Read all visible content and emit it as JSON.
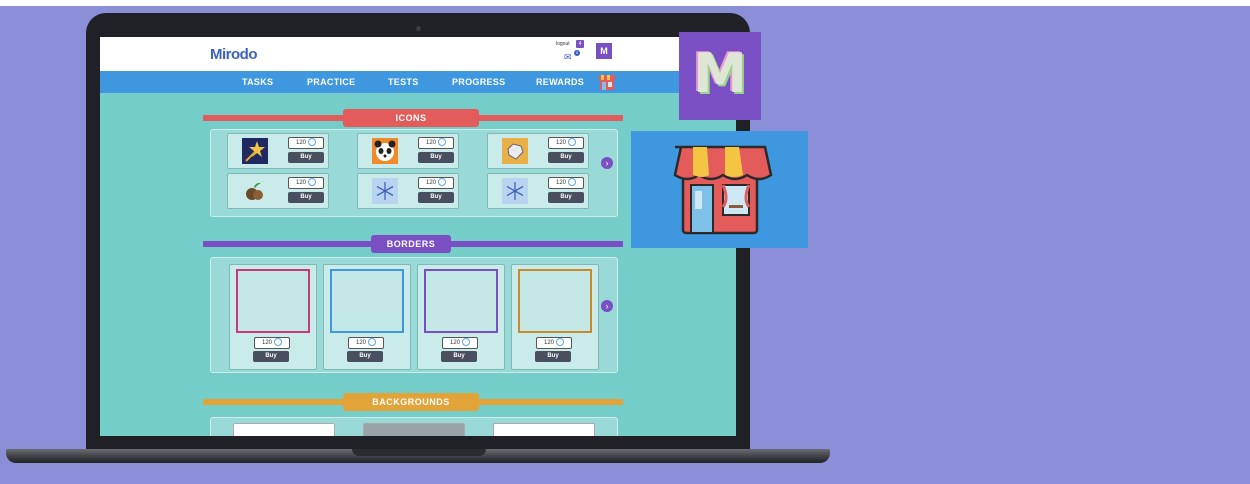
{
  "app": {
    "logo": "Mirodo",
    "header": {
      "logout": "logout",
      "logout_badge": "4",
      "mail_count": "0",
      "avatar_letter": "M"
    },
    "nav": {
      "items": [
        "TASKS",
        "PRACTICE",
        "TESTS",
        "PROGRESS",
        "REWARDS"
      ]
    }
  },
  "sections": {
    "icons": {
      "title": "ICONS",
      "items": [
        {
          "price": "120",
          "buy": "Buy",
          "icon": "star-wand-icon"
        },
        {
          "price": "120",
          "buy": "Buy",
          "icon": "panda-icon"
        },
        {
          "price": "120",
          "buy": "Buy",
          "icon": "diamond-icon"
        },
        {
          "price": "120",
          "buy": "Buy",
          "icon": "coconut-icon"
        },
        {
          "price": "120",
          "buy": "Buy",
          "icon": "snowflake-icon"
        },
        {
          "price": "120",
          "buy": "Buy",
          "icon": "snowflake-icon"
        }
      ]
    },
    "borders": {
      "title": "BORDERS",
      "items": [
        {
          "price": "120",
          "buy": "Buy",
          "color": "#c73a78"
        },
        {
          "price": "120",
          "buy": "Buy",
          "color": "#3f97e0"
        },
        {
          "price": "120",
          "buy": "Buy",
          "color": "#7b4fc4"
        },
        {
          "price": "120",
          "buy": "Buy",
          "color": "#c88a2a"
        }
      ]
    },
    "backgrounds": {
      "title": "BACKGROUNDS"
    }
  },
  "colors": {
    "icons_ribbon": "#e45b5b",
    "borders_ribbon": "#7b4fc4",
    "backgrounds_ribbon": "#e2a338",
    "nav": "#3f97e0",
    "backdrop": "#8a8fd8"
  },
  "callouts": {
    "avatar_letter": "M",
    "shop": "shop-icon"
  }
}
